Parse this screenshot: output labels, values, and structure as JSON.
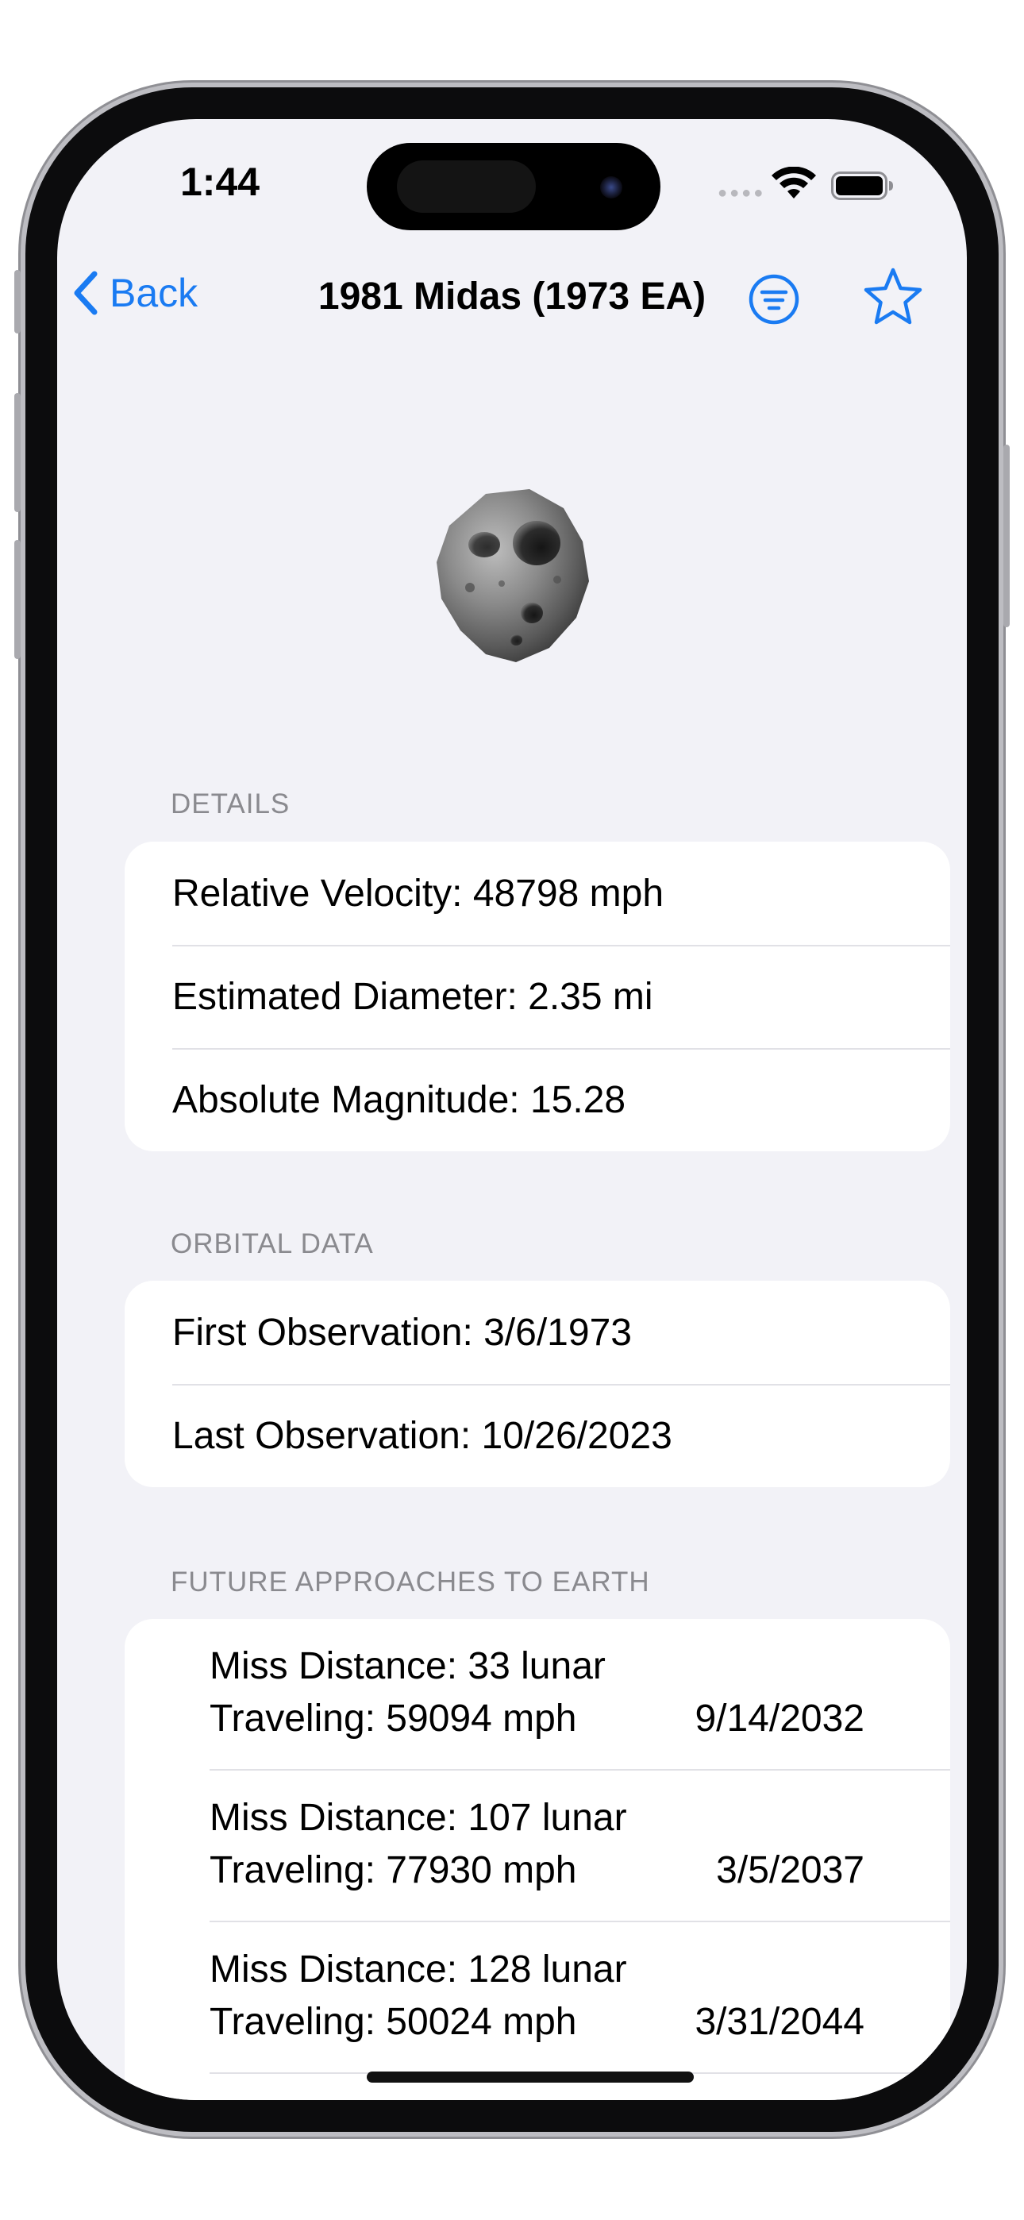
{
  "status_bar": {
    "time": "1:44",
    "signal_icon": "cellular-dots-icon",
    "wifi_icon": "wifi-icon",
    "battery_icon": "battery-full-icon"
  },
  "nav": {
    "back_label": "Back",
    "title": "1981 Midas (1973 EA)",
    "filter_icon": "filter-circle-icon",
    "favorite_icon": "star-outline-icon",
    "accent_color": "#1a7bf2"
  },
  "hero": {
    "image": "asteroid-3d-model"
  },
  "details": {
    "header": "DETAILS",
    "rows": [
      "Relative Velocity: 48798 mph",
      "Estimated Diameter: 2.35 mi",
      "Absolute Magnitude: 15.28"
    ]
  },
  "orbital": {
    "header": "ORBITAL DATA",
    "rows": [
      "First Observation: 3/6/1973",
      "Last Observation: 10/26/2023"
    ]
  },
  "approaches": {
    "header": "FUTURE APPROACHES TO EARTH",
    "items": [
      {
        "distance": "Miss Distance: 33 lunar",
        "speed": "Traveling: 59094 mph",
        "date": "9/14/2032"
      },
      {
        "distance": "Miss Distance: 107 lunar",
        "speed": "Traveling: 77930 mph",
        "date": "3/5/2037"
      },
      {
        "distance": "Miss Distance: 128 lunar",
        "speed": "Traveling: 50024 mph",
        "date": "3/31/2044"
      }
    ]
  }
}
